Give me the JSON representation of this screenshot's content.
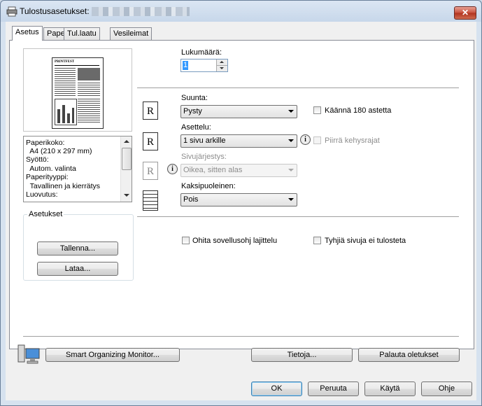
{
  "window": {
    "title": "Tulostusasetukset:",
    "close_label": "✕"
  },
  "tabs": [
    {
      "label": "Asetus"
    },
    {
      "label": "Paperi"
    },
    {
      "label": "Tul.laatu"
    },
    {
      "label": "Vesileimat"
    }
  ],
  "preview": {
    "masthead": "PRINTFEST"
  },
  "info_list": [
    "Paperikoko:",
    "  A4 (210 x 297 mm)",
    "Syöttö:",
    "  Autom. valinta",
    "Paperityyppi:",
    "  Tavallinen ja kierrätys",
    "Luovutus:"
  ],
  "settings_group": {
    "title": "Asetukset",
    "save_label": "Tallenna...",
    "load_label": "Lataa..."
  },
  "copies": {
    "label": "Lukumäärä:",
    "value": "1"
  },
  "orientation": {
    "label": "Suunta:",
    "value": "Pysty",
    "rotate_label": "Käännä 180 astetta"
  },
  "layout": {
    "label": "Asettelu:",
    "value": "1 sivu arkille",
    "border_label": "Piirrä kehysrajat"
  },
  "page_order": {
    "label": "Sivujärjestys:",
    "value": "Oikea, sitten alas"
  },
  "duplex": {
    "label": "Kaksipuoleinen:",
    "value": "Pois"
  },
  "options": {
    "collate_label": "Ohita sovellusohj lajittelu",
    "blank_label": "Tyhjiä sivuja ei tulosteta"
  },
  "footer": {
    "monitor_label": "Smart Organizing Monitor...",
    "about_label": "Tietoja...",
    "restore_label": "Palauta oletukset"
  },
  "dialog_buttons": {
    "ok": "OK",
    "cancel": "Peruuta",
    "apply": "Käytä",
    "help": "Ohje"
  },
  "glyphs": {
    "orient_glyph": "R",
    "info_glyph": "i"
  }
}
